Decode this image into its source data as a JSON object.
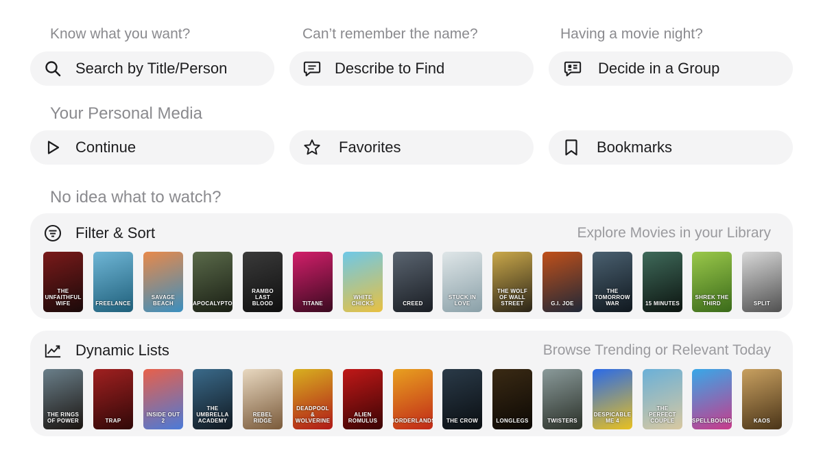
{
  "search_section": {
    "prompts": [
      "Know what you want?",
      "Can’t remember the name?",
      "Having a movie night?"
    ],
    "buttons": [
      {
        "label": "Search by Title/Person",
        "icon": "search-icon"
      },
      {
        "label": "Describe to Find",
        "icon": "chat-bubble-icon"
      },
      {
        "label": "Decide in a Group",
        "icon": "group-chat-icon"
      }
    ]
  },
  "personal_section": {
    "heading": "Your Personal Media",
    "buttons": [
      {
        "label": "Continue",
        "icon": "play-icon"
      },
      {
        "label": "Favorites",
        "icon": "star-icon"
      },
      {
        "label": "Bookmarks",
        "icon": "bookmark-icon"
      }
    ]
  },
  "discover_section": {
    "heading": "No idea what to watch?"
  },
  "filter_card": {
    "title": "Filter & Sort",
    "subtitle": "Explore Movies in your Library",
    "icon": "filter-lines-icon",
    "posters": [
      {
        "title": "The Unfaithful Wife",
        "colors": [
          "#7a1a1a",
          "#1a0a0a"
        ]
      },
      {
        "title": "Freelance",
        "colors": [
          "#6fb6d6",
          "#1f5f7a"
        ]
      },
      {
        "title": "Savage Beach",
        "colors": [
          "#e8894a",
          "#3a8fbf"
        ]
      },
      {
        "title": "Apocalypto",
        "colors": [
          "#5a6a4a",
          "#1a1f14"
        ]
      },
      {
        "title": "Rambo Last Blood",
        "colors": [
          "#3a3a3a",
          "#0f0f0f"
        ]
      },
      {
        "title": "Titane",
        "colors": [
          "#d21f6a",
          "#3a0a20"
        ]
      },
      {
        "title": "White Chicks",
        "colors": [
          "#6ec8e8",
          "#e8c040"
        ]
      },
      {
        "title": "Creed",
        "colors": [
          "#5a6470",
          "#1a1e24"
        ]
      },
      {
        "title": "Stuck in Love",
        "colors": [
          "#dfe6e8",
          "#8aa0a8"
        ]
      },
      {
        "title": "The Wolf of Wall Street",
        "colors": [
          "#caa84a",
          "#2a2418"
        ]
      },
      {
        "title": "G.I. Joe",
        "colors": [
          "#c0501a",
          "#202838"
        ]
      },
      {
        "title": "The Tomorrow War",
        "colors": [
          "#4a6070",
          "#10181f"
        ]
      },
      {
        "title": "15 Minutes",
        "colors": [
          "#3f6a5a",
          "#0c1410"
        ]
      },
      {
        "title": "Shrek the Third",
        "colors": [
          "#9ac84a",
          "#3a6a1a"
        ]
      },
      {
        "title": "Split",
        "colors": [
          "#d8d8d8",
          "#505050"
        ]
      }
    ]
  },
  "dynamic_card": {
    "title": "Dynamic Lists",
    "subtitle": "Browse Trending or Relevant Today",
    "icon": "trending-chart-icon",
    "posters": [
      {
        "title": "The Rings of Power",
        "colors": [
          "#6a7f8a",
          "#1a1410"
        ]
      },
      {
        "title": "Trap",
        "colors": [
          "#a02020",
          "#300808"
        ]
      },
      {
        "title": "Inside Out 2",
        "colors": [
          "#e8604a",
          "#4a7ad8"
        ]
      },
      {
        "title": "The Umbrella Academy",
        "colors": [
          "#3a6a8a",
          "#101820"
        ]
      },
      {
        "title": "Rebel Ridge",
        "colors": [
          "#e8d8c0",
          "#7a5a3a"
        ]
      },
      {
        "title": "Deadpool & Wolverine",
        "colors": [
          "#d8b020",
          "#b01818"
        ]
      },
      {
        "title": "Alien Romulus",
        "colors": [
          "#c01818",
          "#3a0404"
        ]
      },
      {
        "title": "Borderlands",
        "colors": [
          "#e8a020",
          "#c02818"
        ]
      },
      {
        "title": "The Crow",
        "colors": [
          "#2a3a48",
          "#0a0e12"
        ]
      },
      {
        "title": "Longlegs",
        "colors": [
          "#3a2a14",
          "#0c0804"
        ]
      },
      {
        "title": "Twisters",
        "colors": [
          "#8a9a9a",
          "#2a3028"
        ]
      },
      {
        "title": "Despicable Me 4",
        "colors": [
          "#2a6ae8",
          "#e8c020"
        ]
      },
      {
        "title": "The Perfect Couple",
        "colors": [
          "#6ab0d8",
          "#d8c8a0"
        ]
      },
      {
        "title": "Spellbound",
        "colors": [
          "#38a8e8",
          "#c83a8a"
        ]
      },
      {
        "title": "Kaos",
        "colors": [
          "#c8a060",
          "#4a3418"
        ]
      }
    ]
  }
}
